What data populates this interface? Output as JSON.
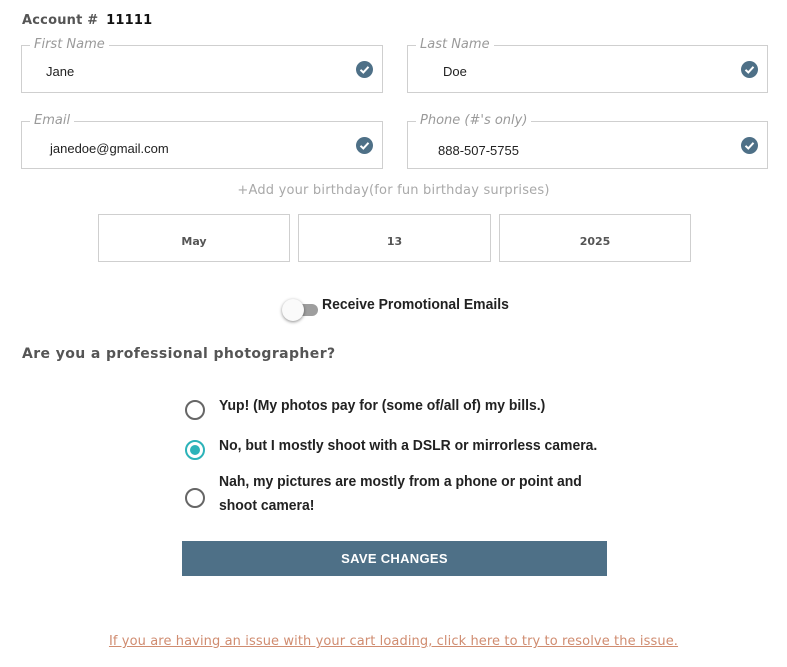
{
  "account": {
    "label": "Account #",
    "number": "11111"
  },
  "fields": {
    "first_name": {
      "label": "First Name",
      "value": "Jane"
    },
    "last_name": {
      "label": "Last Name",
      "value": "Doe"
    },
    "email": {
      "label": "Email",
      "value": "janedoe@gmail.com"
    },
    "phone": {
      "label": "Phone (#'s only)",
      "value": "888-507-5755"
    }
  },
  "birthday": {
    "link_text": "+Add your birthday(for fun birthday surprises)",
    "month": "May",
    "day": "13",
    "year": "2025"
  },
  "promo": {
    "label": "Receive Promotional Emails",
    "enabled": false
  },
  "photographer": {
    "question": "Are you a professional photographer?",
    "options": [
      {
        "label": "Yup! (My photos pay for (some of/all of) my bills.)",
        "selected": false
      },
      {
        "label": "No, but I mostly shoot with a DSLR or mirrorless camera.",
        "selected": true
      },
      {
        "label": "Nah, my pictures are mostly from a phone or point and shoot camera!",
        "selected": false
      }
    ]
  },
  "save_button": "SAVE CHANGES",
  "cart_link": "If you are having an issue with your cart loading, click here to try to resolve the issue.",
  "colors": {
    "accent": "#4e7087",
    "radio_selected": "#2cb3b9",
    "link": "#d08c70"
  },
  "icons": {
    "valid": "check-circle-icon"
  }
}
